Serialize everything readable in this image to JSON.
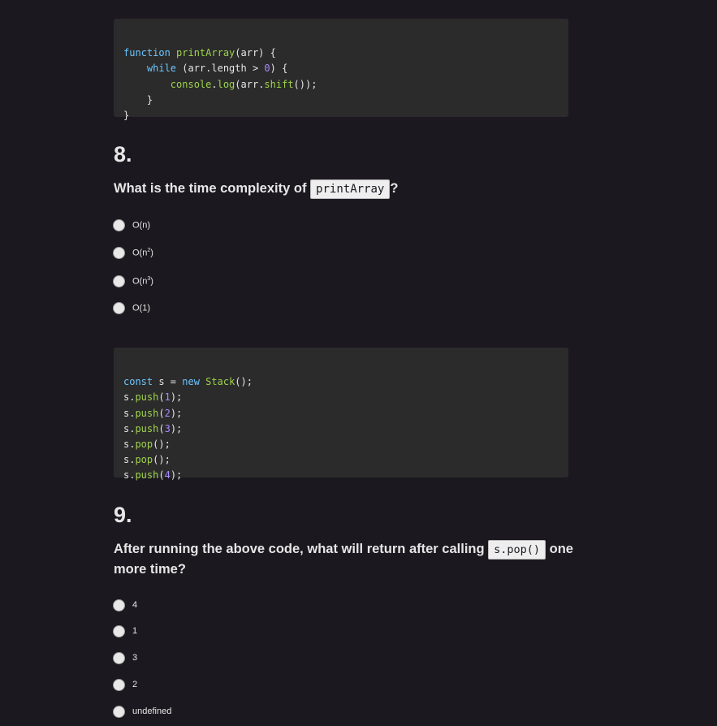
{
  "code_block_1": {
    "lines": [
      "function printArray(arr) {",
      "    while (arr.length > 0) {",
      "        console.log(arr.shift());",
      "    }",
      "}"
    ]
  },
  "question_8": {
    "number": "8.",
    "text_before": "What is the time complexity of ",
    "inline_code": "printArray",
    "text_after": "?",
    "options": [
      {
        "base": "O(n",
        "sup": "",
        "close": ")"
      },
      {
        "base": "O(n",
        "sup": "2",
        "close": ")"
      },
      {
        "base": "O(n",
        "sup": "3",
        "close": ")"
      },
      {
        "base": "O(1",
        "sup": "",
        "close": ")"
      }
    ]
  },
  "code_block_2": {
    "lines": [
      "const s = new Stack();",
      "s.push(1);",
      "s.push(2);",
      "s.push(3);",
      "s.pop();",
      "s.pop();",
      "s.push(4);"
    ]
  },
  "question_9": {
    "number": "9.",
    "text_before": "After running the above code, what will return after calling ",
    "inline_code": "s.pop()",
    "text_after": " one more time?",
    "options": [
      "4",
      "1",
      "3",
      "2",
      "undefined"
    ]
  },
  "colors": {
    "background": "#1b181f",
    "code_background": "#2b2b2b",
    "keyword": "#6bc5ff",
    "function": "#9ed34b",
    "number": "#a78bff"
  }
}
